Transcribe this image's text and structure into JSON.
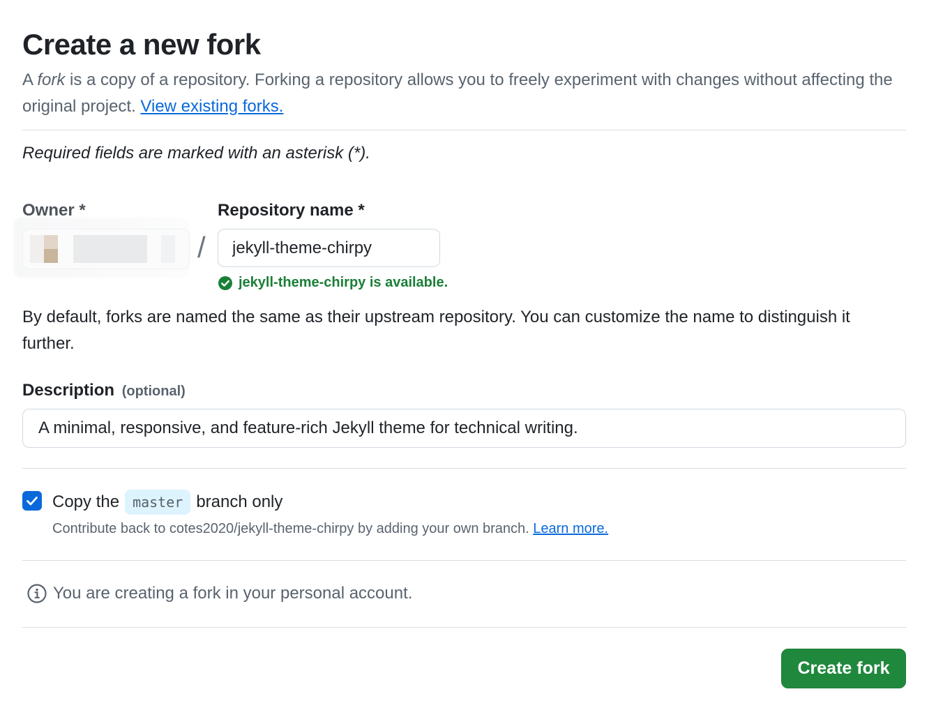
{
  "page": {
    "title": "Create a new fork",
    "intro": {
      "prefix": "A ",
      "fork_word": "fork",
      "text": " is a copy of a repository. Forking a repository allows you to freely experiment with changes without affecting the original project. ",
      "link_label": "View existing forks."
    },
    "required_note": "Required fields are marked with an asterisk (*)."
  },
  "owner": {
    "label": "Owner *",
    "slash": "/"
  },
  "repository": {
    "label": "Repository name *",
    "value": "jekyll-theme-chirpy",
    "availability": "jekyll-theme-chirpy is available.",
    "availability_icon": "check-circle-fill-icon",
    "success_color": "#1a7f37"
  },
  "default_note": "By default, forks are named the same as their upstream repository. You can customize the name to distinguish it further.",
  "description": {
    "label": "Description",
    "optional": "(optional)",
    "value": "A minimal, responsive, and feature-rich Jekyll theme for technical writing."
  },
  "copy_branch": {
    "checked": true,
    "label_prefix": "Copy the",
    "branch": "master",
    "label_suffix": "branch only",
    "sub_text": "Contribute back to cotes2020/jekyll-theme-chirpy by adding your own branch. ",
    "learn_more": "Learn more.",
    "accent_color": "#0969da"
  },
  "info": {
    "icon": "info-icon",
    "text": "You are creating a fork in your personal account."
  },
  "actions": {
    "create_label": "Create fork",
    "create_color": "#1f883d"
  }
}
